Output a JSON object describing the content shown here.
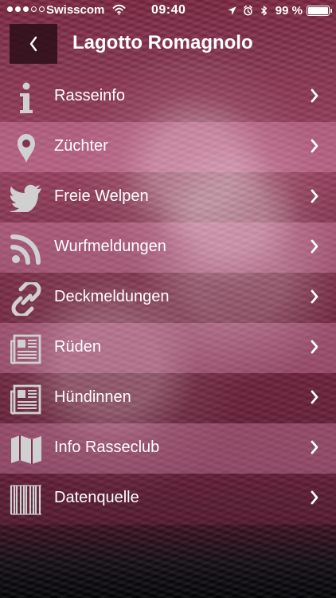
{
  "status_bar": {
    "carrier": "Swisscom",
    "time": "09:40",
    "battery": "99 %",
    "battery_level": 0.99,
    "icons": [
      "signal-dots-icon",
      "wifi-icon",
      "location-arrow-icon",
      "alarm-icon",
      "bluetooth-icon",
      "battery-icon"
    ]
  },
  "header": {
    "title": "Lagotto Romagnolo",
    "back_icon": "chevron-left-icon"
  },
  "menu": {
    "items": [
      {
        "label": "Rasseinfo",
        "icon": "info-icon"
      },
      {
        "label": "Züchter",
        "icon": "location-pin-icon"
      },
      {
        "label": "Freie Welpen",
        "icon": "twitter-bird-icon"
      },
      {
        "label": "Wurfmeldungen",
        "icon": "rss-feed-icon"
      },
      {
        "label": "Deckmeldungen",
        "icon": "link-icon"
      },
      {
        "label": "Rüden",
        "icon": "newspaper-icon"
      },
      {
        "label": "Hündinnen",
        "icon": "newspaper-icon"
      },
      {
        "label": "Info Rasseclub",
        "icon": "map-icon"
      },
      {
        "label": "Datenquelle",
        "icon": "barcode-icon"
      }
    ],
    "chevron_icon": "chevron-right-icon"
  },
  "colors": {
    "text": "#ffffff",
    "icon": "#cfcfcf",
    "header_button": "#2a0e18",
    "row_light": "#d27ea0",
    "row_dark": "#8f3654"
  }
}
